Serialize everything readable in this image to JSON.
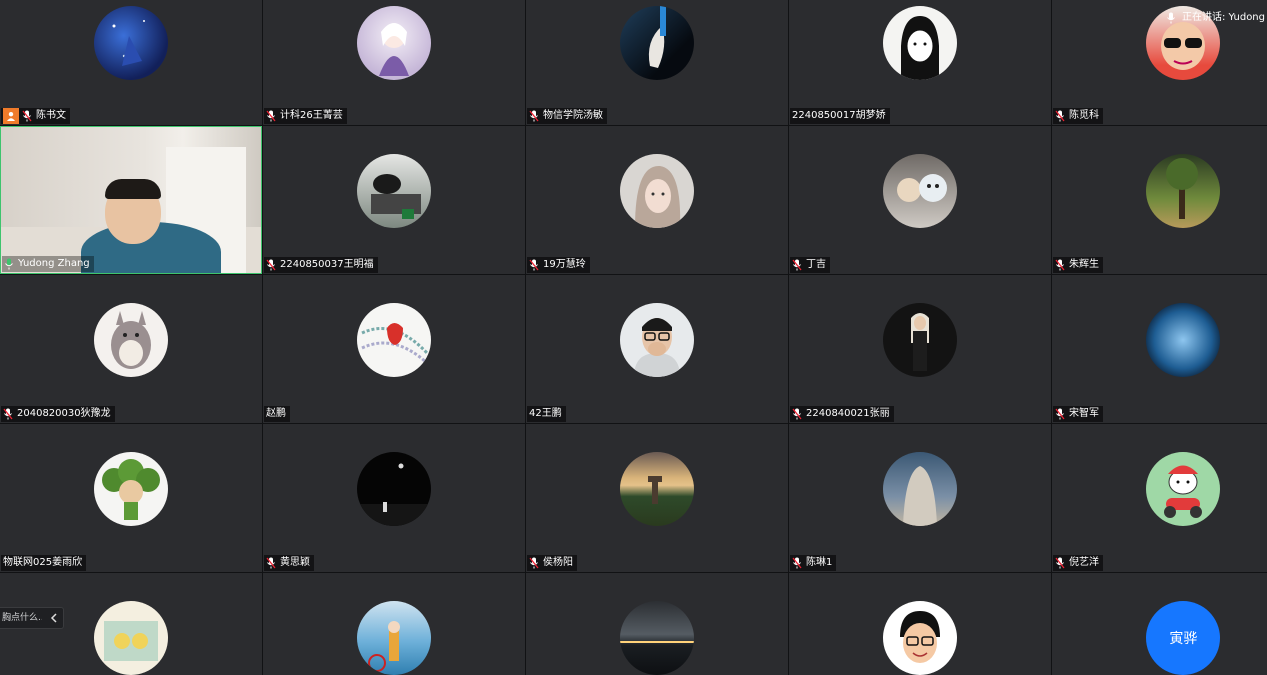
{
  "active_speaker": {
    "label": "正在讲话: Yudong"
  },
  "chat_tab": {
    "text": "胸点什么..."
  },
  "participants": [
    {
      "name": "陈书文",
      "host": true
    },
    {
      "name": "计科26王菁芸"
    },
    {
      "name": "物信学院汤敏"
    },
    {
      "name": "2240850017胡梦娇",
      "no_mic": true
    },
    {
      "name": "陈觅科"
    },
    {
      "name": "Yudong Zhang",
      "video": true
    },
    {
      "name": "2240850037王明福"
    },
    {
      "name": "19万慧玲"
    },
    {
      "name": "丁吉"
    },
    {
      "name": "朱辉生"
    },
    {
      "name": "2040820030狄豫龙"
    },
    {
      "name": "赵鹏",
      "no_mic": true
    },
    {
      "name": "42王鹏",
      "no_mic": true
    },
    {
      "name": "2240840021张丽"
    },
    {
      "name": "宋智军"
    },
    {
      "name": "物联网025姜雨欣",
      "no_mic": true
    },
    {
      "name": "黄思颖"
    },
    {
      "name": "侯杨阳"
    },
    {
      "name": "陈琳1"
    },
    {
      "name": "倪艺洋"
    },
    {
      "name": ""
    },
    {
      "name": ""
    },
    {
      "name": ""
    },
    {
      "name": ""
    },
    {
      "name": "",
      "text_avatar": "寅骅"
    }
  ],
  "colors": {
    "tile_bg": "#2b2c2f",
    "accent_speaking_border": "#3ec46d",
    "host_badge": "#f07b2a",
    "text_avatar_bg": "#1677ff"
  }
}
